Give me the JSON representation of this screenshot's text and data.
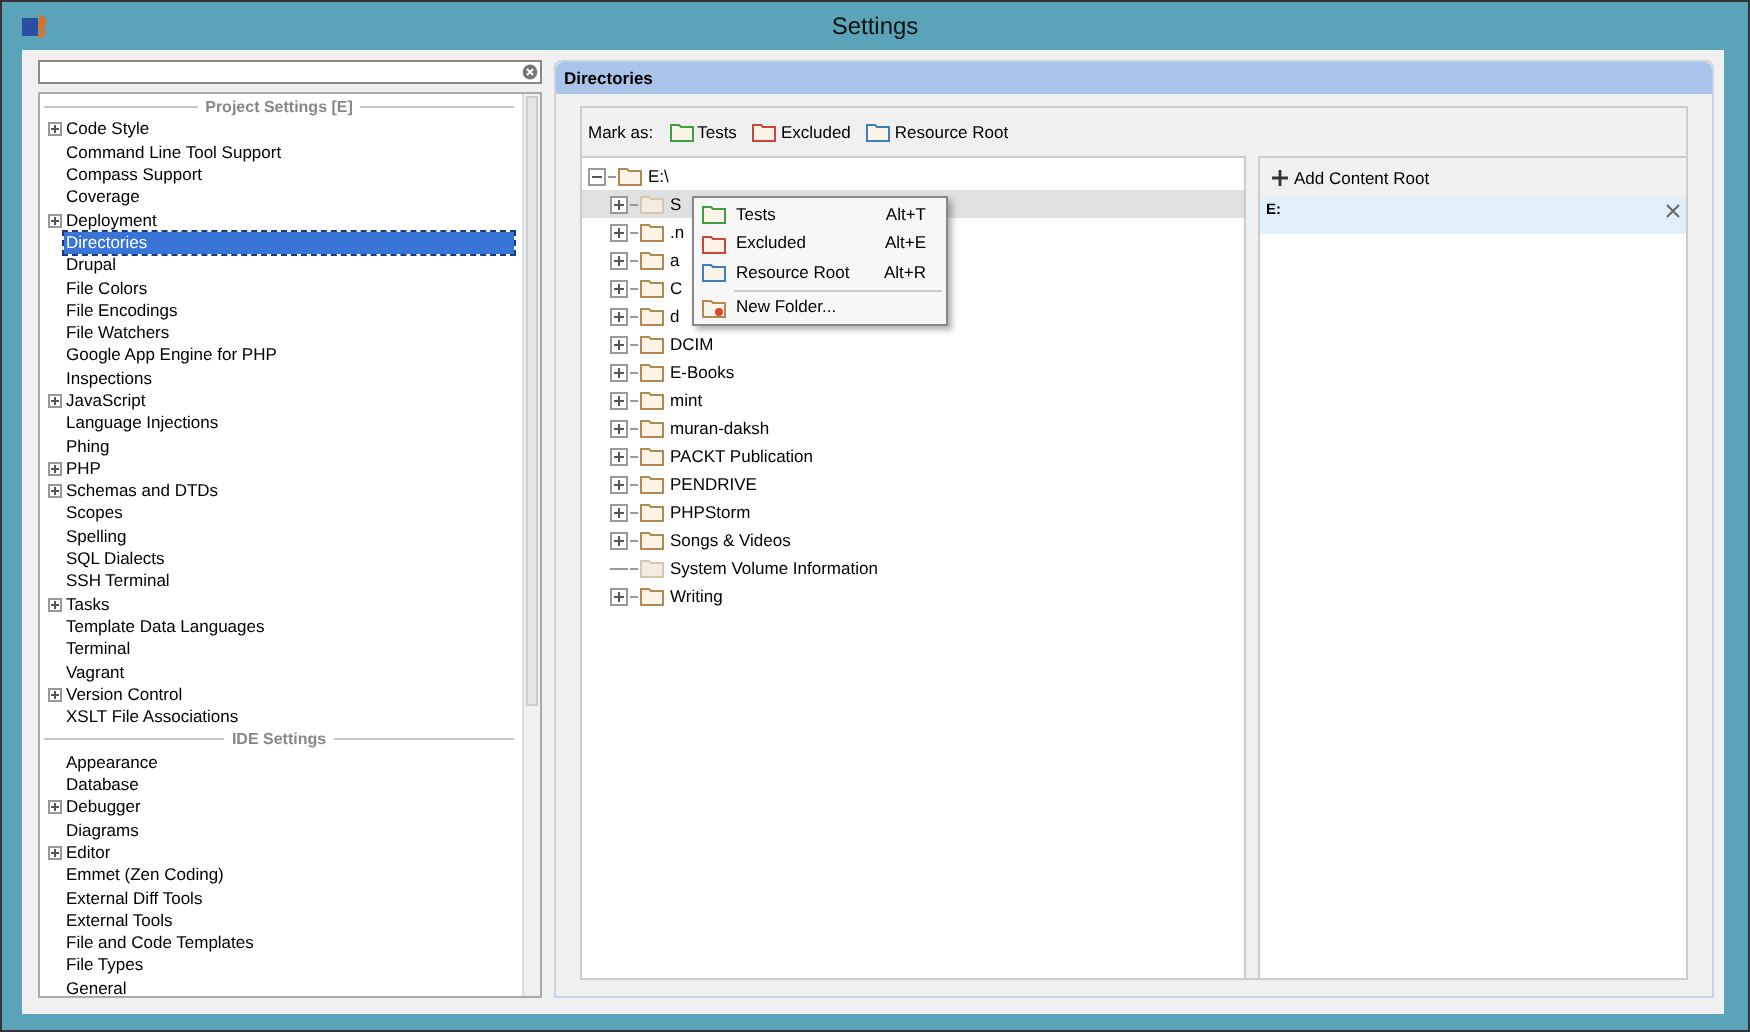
{
  "window": {
    "title": "Settings"
  },
  "settings_groups": [
    {
      "title": "Project Settings [E]",
      "items": [
        {
          "label": "Code Style",
          "expandable": true,
          "selected": false
        },
        {
          "label": "Command Line Tool Support",
          "expandable": false,
          "selected": false
        },
        {
          "label": "Compass Support",
          "expandable": false,
          "selected": false
        },
        {
          "label": "Coverage",
          "expandable": false,
          "selected": false
        },
        {
          "label": "Deployment",
          "expandable": true,
          "selected": false
        },
        {
          "label": "Directories",
          "expandable": false,
          "selected": true
        },
        {
          "label": "Drupal",
          "expandable": false,
          "selected": false
        },
        {
          "label": "File Colors",
          "expandable": false,
          "selected": false
        },
        {
          "label": "File Encodings",
          "expandable": false,
          "selected": false
        },
        {
          "label": "File Watchers",
          "expandable": false,
          "selected": false
        },
        {
          "label": "Google App Engine for PHP",
          "expandable": false,
          "selected": false
        },
        {
          "label": "Inspections",
          "expandable": false,
          "selected": false
        },
        {
          "label": "JavaScript",
          "expandable": true,
          "selected": false
        },
        {
          "label": "Language Injections",
          "expandable": false,
          "selected": false
        },
        {
          "label": "Phing",
          "expandable": false,
          "selected": false
        },
        {
          "label": "PHP",
          "expandable": true,
          "selected": false
        },
        {
          "label": "Schemas and DTDs",
          "expandable": true,
          "selected": false
        },
        {
          "label": "Scopes",
          "expandable": false,
          "selected": false
        },
        {
          "label": "Spelling",
          "expandable": false,
          "selected": false
        },
        {
          "label": "SQL Dialects",
          "expandable": false,
          "selected": false
        },
        {
          "label": "SSH Terminal",
          "expandable": false,
          "selected": false
        },
        {
          "label": "Tasks",
          "expandable": true,
          "selected": false
        },
        {
          "label": "Template Data Languages",
          "expandable": false,
          "selected": false
        },
        {
          "label": "Terminal",
          "expandable": false,
          "selected": false
        },
        {
          "label": "Vagrant",
          "expandable": false,
          "selected": false
        },
        {
          "label": "Version Control",
          "expandable": true,
          "selected": false
        },
        {
          "label": "XSLT File Associations",
          "expandable": false,
          "selected": false
        }
      ]
    },
    {
      "title": "IDE Settings",
      "items": [
        {
          "label": "Appearance",
          "expandable": false,
          "selected": false
        },
        {
          "label": "Database",
          "expandable": false,
          "selected": false
        },
        {
          "label": "Debugger",
          "expandable": true,
          "selected": false
        },
        {
          "label": "Diagrams",
          "expandable": false,
          "selected": false
        },
        {
          "label": "Editor",
          "expandable": true,
          "selected": false
        },
        {
          "label": "Emmet (Zen Coding)",
          "expandable": false,
          "selected": false
        },
        {
          "label": "External Diff Tools",
          "expandable": false,
          "selected": false
        },
        {
          "label": "External Tools",
          "expandable": false,
          "selected": false
        },
        {
          "label": "File and Code Templates",
          "expandable": false,
          "selected": false
        },
        {
          "label": "File Types",
          "expandable": false,
          "selected": false
        },
        {
          "label": "General",
          "expandable": false,
          "selected": false
        }
      ]
    }
  ],
  "panel": {
    "title": "Directories",
    "mark_as": {
      "label": "Mark as:",
      "options": [
        {
          "label": "Tests",
          "color": "#3f9e3f"
        },
        {
          "label": "Excluded",
          "color": "#c9463d"
        },
        {
          "label": "Resource Root",
          "color": "#3f7fb5"
        }
      ]
    },
    "tree": {
      "label": "E:\\",
      "expanded": true,
      "children": [
        {
          "label": "S",
          "expandable": true,
          "selected": true,
          "pale": true
        },
        {
          "label": ".n",
          "expandable": true,
          "selected": false,
          "pale": false
        },
        {
          "label": "a",
          "expandable": true,
          "selected": false,
          "pale": false
        },
        {
          "label": "C",
          "expandable": true,
          "selected": false,
          "pale": false
        },
        {
          "label": "d",
          "expandable": true,
          "selected": false,
          "pale": false
        },
        {
          "label": "DCIM",
          "expandable": true,
          "selected": false,
          "pale": false
        },
        {
          "label": "E-Books",
          "expandable": true,
          "selected": false,
          "pale": false
        },
        {
          "label": "mint",
          "expandable": true,
          "selected": false,
          "pale": false
        },
        {
          "label": "muran-daksh",
          "expandable": true,
          "selected": false,
          "pale": false
        },
        {
          "label": "PACKT Publication",
          "expandable": true,
          "selected": false,
          "pale": false
        },
        {
          "label": "PENDRIVE",
          "expandable": true,
          "selected": false,
          "pale": false
        },
        {
          "label": "PHPStorm",
          "expandable": true,
          "selected": false,
          "pale": false
        },
        {
          "label": "Songs & Videos",
          "expandable": true,
          "selected": false,
          "pale": false
        },
        {
          "label": "System Volume Information",
          "expandable": false,
          "selected": false,
          "pale": true
        },
        {
          "label": "Writing",
          "expandable": true,
          "selected": false,
          "pale": false
        }
      ]
    },
    "context_menu": {
      "items": [
        {
          "kind": "mark",
          "label": "Tests",
          "shortcut": "Alt+T",
          "color": "#3f9e3f"
        },
        {
          "kind": "mark",
          "label": "Excluded",
          "shortcut": "Alt+E",
          "color": "#c9463d"
        },
        {
          "kind": "mark",
          "label": "Resource Root",
          "shortcut": "Alt+R",
          "color": "#3f7fb5"
        },
        {
          "kind": "separator"
        },
        {
          "kind": "new-folder",
          "label": "New Folder..."
        }
      ]
    },
    "content_roots": {
      "add_label": "Add Content Root",
      "roots": [
        {
          "label": "E:",
          "selected": true
        }
      ]
    }
  }
}
